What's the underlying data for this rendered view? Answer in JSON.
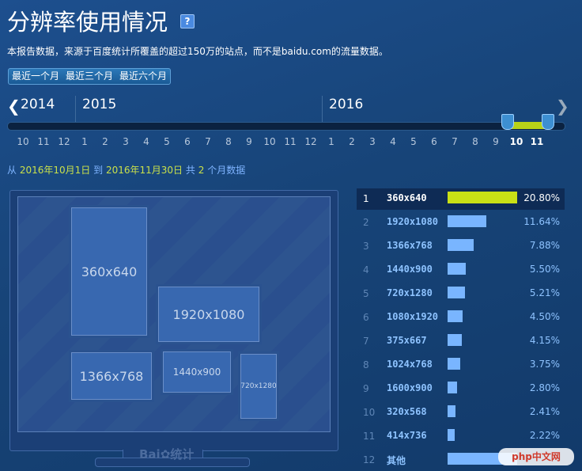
{
  "header": {
    "title": "分辨率使用情况",
    "help": "?",
    "description": "本报告数据，来源于百度统计所覆盖的超过150万的站点，而不是baidu.com的流量数据。"
  },
  "range_tabs": [
    "最近一个月",
    "最近三个月",
    "最近六个月"
  ],
  "timeline": {
    "years": [
      "2014",
      "2015",
      "2016"
    ],
    "months": [
      "10",
      "11",
      "12",
      "1",
      "2",
      "3",
      "4",
      "5",
      "6",
      "7",
      "8",
      "9",
      "10",
      "11",
      "12",
      "1",
      "2",
      "3",
      "4",
      "5",
      "6",
      "7",
      "8",
      "9",
      "10",
      "11"
    ],
    "selected_months": [
      "10",
      "11"
    ]
  },
  "period": {
    "from_label": "从",
    "start": "2016年10月1日",
    "to_label": "到",
    "end": "2016年11月30日",
    "total_label": "共",
    "count": "2",
    "suffix": "个月数据"
  },
  "monitor": {
    "logo": "Bai",
    "logo_tail": "统计",
    "boxes": [
      "360x640",
      "1920x1080",
      "1366x768",
      "1440x900",
      "720x1280"
    ]
  },
  "ranking": [
    {
      "rank": "1",
      "res": "360x640",
      "pct": "20.80%",
      "value": 20.8
    },
    {
      "rank": "2",
      "res": "1920x1080",
      "pct": "11.64%",
      "value": 11.64
    },
    {
      "rank": "3",
      "res": "1366x768",
      "pct": "7.88%",
      "value": 7.88
    },
    {
      "rank": "4",
      "res": "1440x900",
      "pct": "5.50%",
      "value": 5.5
    },
    {
      "rank": "5",
      "res": "720x1280",
      "pct": "5.21%",
      "value": 5.21
    },
    {
      "rank": "6",
      "res": "1080x1920",
      "pct": "4.50%",
      "value": 4.5
    },
    {
      "rank": "7",
      "res": "375x667",
      "pct": "4.15%",
      "value": 4.15
    },
    {
      "rank": "8",
      "res": "1024x768",
      "pct": "3.75%",
      "value": 3.75
    },
    {
      "rank": "9",
      "res": "1600x900",
      "pct": "2.80%",
      "value": 2.8
    },
    {
      "rank": "10",
      "res": "320x568",
      "pct": "2.41%",
      "value": 2.41
    },
    {
      "rank": "11",
      "res": "414x736",
      "pct": "2.22%",
      "value": 2.22
    },
    {
      "rank": "12",
      "res": "其他",
      "pct": "",
      "value": 20.8
    }
  ],
  "watermark": "php中文网",
  "colors": {
    "accent": "#c9e016",
    "bar": "#79b5ff",
    "highlight_text": "#c9e04a"
  }
}
